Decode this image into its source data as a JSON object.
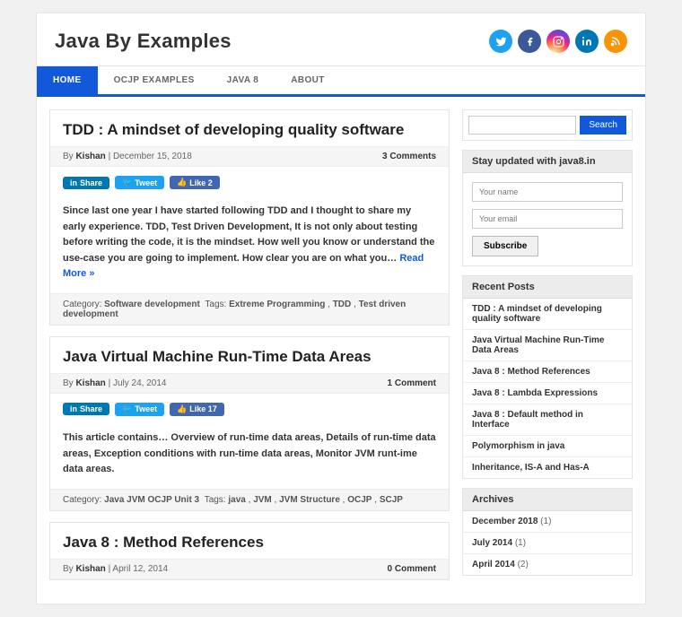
{
  "site_title": "Java By Examples",
  "social": [
    "twitter",
    "facebook",
    "instagram",
    "linkedin",
    "rss"
  ],
  "nav": [
    {
      "label": "HOME",
      "active": true
    },
    {
      "label": "OCJP EXAMPLES",
      "active": false
    },
    {
      "label": "JAVA 8",
      "active": false
    },
    {
      "label": "ABOUT",
      "active": false
    }
  ],
  "posts": [
    {
      "title": "TDD : A mindset of developing quality software",
      "author": "Kishan",
      "date": "December 15, 2018",
      "comments": "3 Comments",
      "share_like": "Like 2",
      "excerpt": "Since last one year I have started following TDD and I thought to share my early experience. TDD, Test Driven Development, It is not only about testing before writing the code, it is the mindset. How well you know or understand the use-case you are going to implement. How clear you are on what you… ",
      "read_more": "Read More »",
      "category": "Software development",
      "tags": [
        "Extreme Programming",
        "TDD",
        "Test driven development"
      ]
    },
    {
      "title": "Java Virtual Machine Run-Time Data Areas",
      "author": "Kishan",
      "date": "July 24, 2014",
      "comments": "1 Comment",
      "share_like": "Like 17",
      "excerpt": "This article contains… Overview of run-time data areas, Details of run-time data areas, Exception conditions with run-time data areas, Monitor JVM runt-ime data areas.",
      "read_more": "",
      "category": "Java  JVM  OCJP Unit 3",
      "tags": [
        "java",
        "JVM",
        "JVM Structure",
        "OCJP",
        "SCJP"
      ]
    },
    {
      "title": "Java 8 : Method References",
      "author": "Kishan",
      "date": "April 12, 2014",
      "comments": "0 Comment",
      "share_like": "",
      "excerpt": "",
      "read_more": "",
      "category": "",
      "tags": []
    }
  ],
  "search": {
    "button": "Search"
  },
  "subscribe": {
    "title": "Stay updated with java8.in",
    "name_placeholder": "Your name",
    "email_placeholder": "Your email",
    "button": "Subscribe"
  },
  "recent_posts": {
    "title": "Recent Posts",
    "items": [
      "TDD : A mindset of developing quality software",
      "Java Virtual Machine Run-Time Data Areas",
      "Java 8 : Method References",
      "Java 8 : Lambda Expressions",
      "Java 8 : Default method in Interface",
      "Polymorphism in java",
      "Inheritance, IS-A and Has-A"
    ]
  },
  "archives": {
    "title": "Archives",
    "items": [
      {
        "label": "December 2018",
        "count": "(1)"
      },
      {
        "label": "July 2014",
        "count": "(1)"
      },
      {
        "label": "April 2014",
        "count": "(2)"
      }
    ]
  },
  "labels": {
    "by": "By",
    "category": "Category:",
    "tags": "Tags:",
    "share": "Share",
    "tweet": "Tweet"
  }
}
